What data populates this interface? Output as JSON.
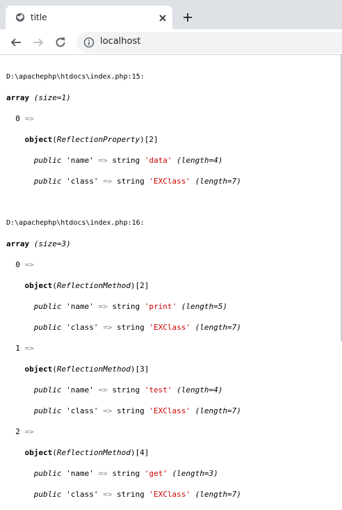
{
  "browser": {
    "tab_title": "title",
    "new_tab_label": "+",
    "url": "localhost",
    "icons": [
      "globe-icon",
      "close-icon",
      "plus-icon",
      "back-arrow-icon",
      "forward-arrow-icon",
      "reload-icon",
      "info-icon"
    ]
  },
  "dump1": {
    "location": "D:\\apachephp\\htdocs\\index.php:15:",
    "array_word": "array",
    "size": "(size=1)",
    "items": [
      {
        "key": "0",
        "class": "ReflectionProperty",
        "index": "[2]",
        "props": [
          {
            "vis": "public",
            "prop": "'name'",
            "type": "string",
            "value": "'data'",
            "length": "(length=4)"
          },
          {
            "vis": "public",
            "prop": "'class'",
            "type": "string",
            "value": "'EXClass'",
            "length": "(length=7)"
          }
        ]
      }
    ]
  },
  "dump2": {
    "location": "D:\\apachephp\\htdocs\\index.php:16:",
    "array_word": "array",
    "size": "(size=3)",
    "items": [
      {
        "key": "0",
        "class": "ReflectionMethod",
        "index": "[2]",
        "props": [
          {
            "vis": "public",
            "prop": "'name'",
            "type": "string",
            "value": "'print'",
            "length": "(length=5)"
          },
          {
            "vis": "public",
            "prop": "'class'",
            "type": "string",
            "value": "'EXClass'",
            "length": "(length=7)"
          }
        ]
      },
      {
        "key": "1",
        "class": "ReflectionMethod",
        "index": "[3]",
        "props": [
          {
            "vis": "public",
            "prop": "'name'",
            "type": "string",
            "value": "'test'",
            "length": "(length=4)"
          },
          {
            "vis": "public",
            "prop": "'class'",
            "type": "string",
            "value": "'EXClass'",
            "length": "(length=7)"
          }
        ]
      },
      {
        "key": "2",
        "class": "ReflectionMethod",
        "index": "[4]",
        "props": [
          {
            "vis": "public",
            "prop": "'name'",
            "type": "string",
            "value": "'get'",
            "length": "(length=3)"
          },
          {
            "vis": "public",
            "prop": "'class'",
            "type": "string",
            "value": "'EXClass'",
            "length": "(length=7)"
          }
        ]
      }
    ]
  }
}
